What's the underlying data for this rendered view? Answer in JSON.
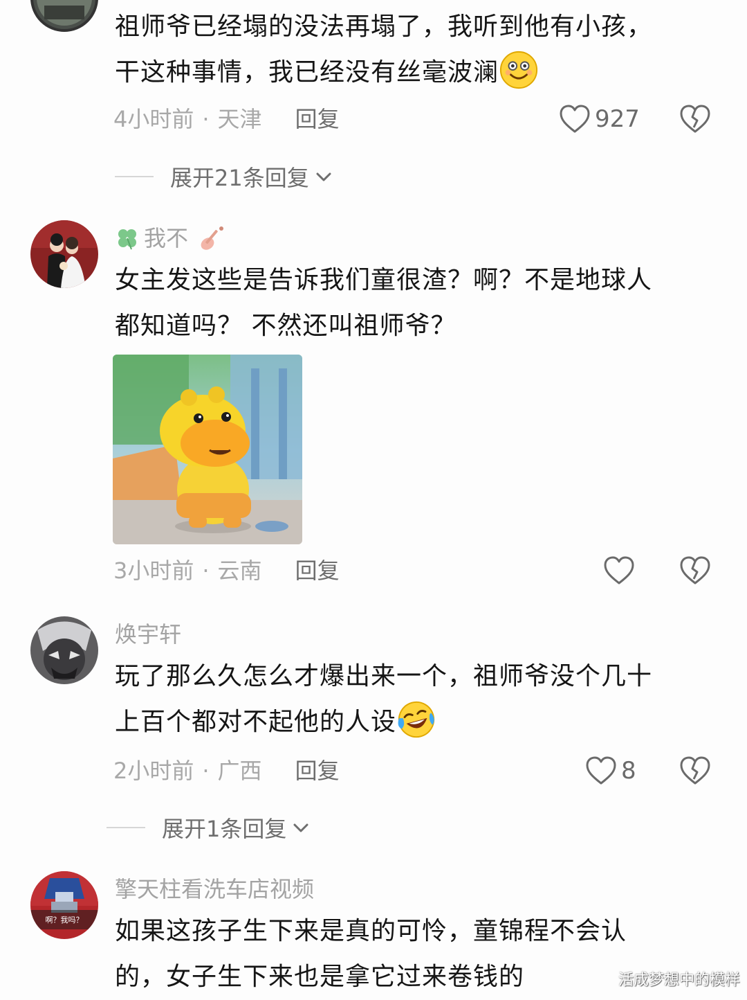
{
  "colors": {
    "background": "#fdfdfd",
    "text_primary": "#151515",
    "text_secondary": "#a8a8a8",
    "reply_gray": "#6e6e6e",
    "like_gray": "#6a6a6a"
  },
  "comments": [
    {
      "lines": [
        "祖师爷已经塌的没法再塌了，我听到他有小孩，",
        "干这种事情，我已经没有丝毫波澜"
      ],
      "emoji": "smiling-face-emoji",
      "time": "4小时前",
      "location": "天津",
      "reply_label": "回复",
      "likes": "927",
      "expand_label": "展开21条回复"
    },
    {
      "username": "我不",
      "username_icons": [
        "four-leaf-clover-icon",
        "guitar-icon"
      ],
      "lines": [
        "女主发这些是告诉我们童很渣？啊？不是地球人",
        "都知道吗？ 不然还叫祖师爷？"
      ],
      "time": "3小时前",
      "location": "云南",
      "reply_label": "回复",
      "likes": ""
    },
    {
      "username": "焕宇轩",
      "lines": [
        "玩了那么久怎么才爆出来一个，祖师爷没个几十",
        "上百个都对不起他的人设"
      ],
      "emoji": "laughing-tears-emoji",
      "time": "2小时前",
      "location": "广西",
      "reply_label": "回复",
      "likes": "8",
      "expand_label": "展开1条回复"
    },
    {
      "username": "擎天柱看洗车店视频",
      "avatar_text": "啊？我吗？",
      "lines": [
        "如果这孩子生下来是真的可怜，童锦程不会认",
        "的，女子生下来也是拿它过来卷钱的"
      ]
    }
  ],
  "separator": "·",
  "watermark": "活成梦想中的模样"
}
